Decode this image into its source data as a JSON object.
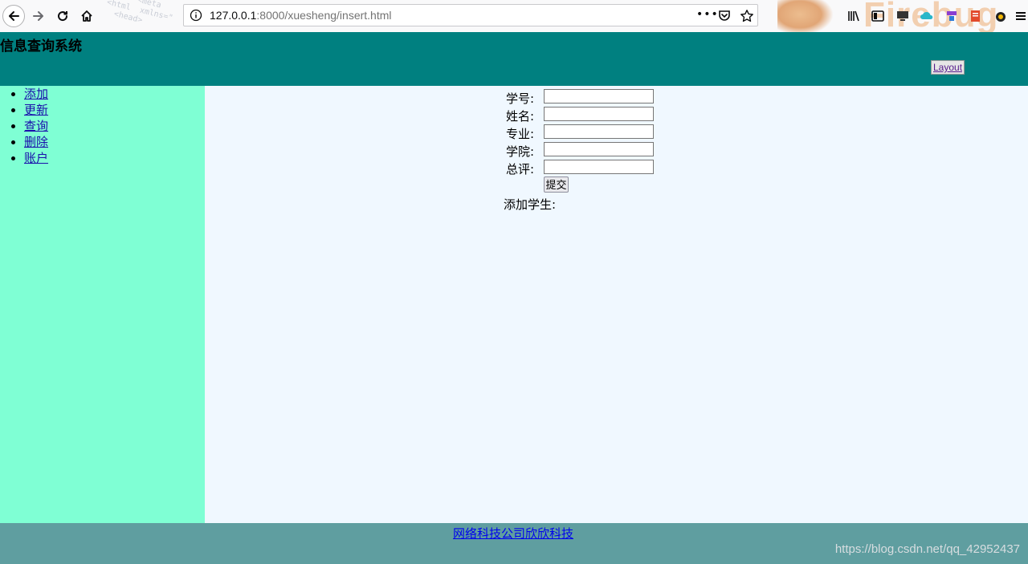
{
  "browser": {
    "url_host": "127.0.0.1",
    "url_rest": ":8000/xuesheng/insert.html",
    "theme_text": "Firebug"
  },
  "header": {
    "title": "信息查询系统",
    "layout_button": "Layout"
  },
  "sidebar": {
    "items": [
      {
        "label": "添加"
      },
      {
        "label": "更新"
      },
      {
        "label": "查询"
      },
      {
        "label": "删除"
      },
      {
        "label": "账户"
      }
    ]
  },
  "form": {
    "fields": [
      {
        "label": "学号:",
        "value": ""
      },
      {
        "label": "姓名:",
        "value": ""
      },
      {
        "label": "专业:",
        "value": ""
      },
      {
        "label": "学院:",
        "value": ""
      },
      {
        "label": "总评:",
        "value": ""
      }
    ],
    "submit_label": "提交",
    "result_text": "添加学生:"
  },
  "footer": {
    "link_text": "网络科技公司欣欣科技",
    "watermark": "https://blog.csdn.net/qq_42952437"
  },
  "colors": {
    "header_bg": "#008080",
    "sidebar_bg": "#7fffd4",
    "main_bg": "#f0f8ff",
    "footer_bg": "#5f9ea0"
  }
}
